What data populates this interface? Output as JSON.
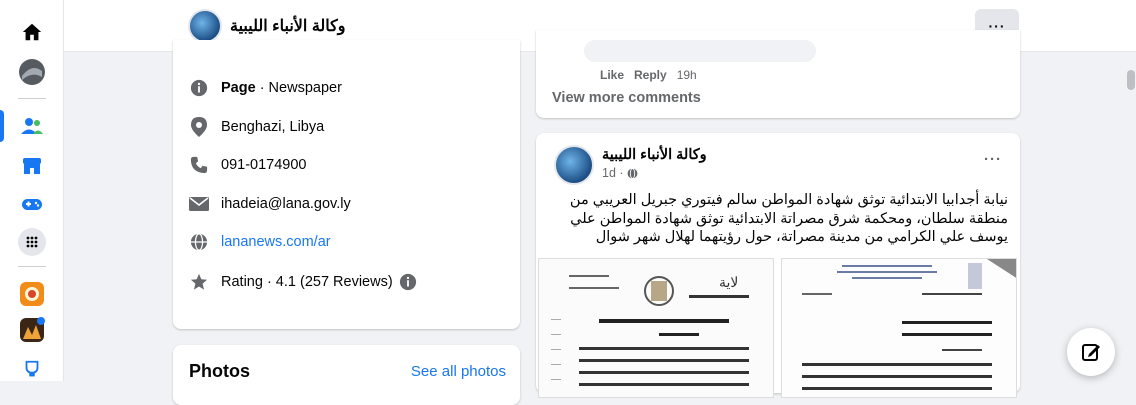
{
  "header": {
    "page_name": "وكالة الأنباء الليبية",
    "more_label": "···"
  },
  "intro": {
    "category": {
      "bold": "Page",
      "rest": " · Newspaper"
    },
    "location": "Benghazi, Libya",
    "phone": "091-0174900",
    "email": "ihadeia@lana.gov.ly",
    "website": "lananews.com/ar",
    "rating": "Rating · 4.1 (257 Reviews)"
  },
  "photos": {
    "title": "Photos",
    "see_all": "See all photos"
  },
  "comments": {
    "like": "Like",
    "reply": "Reply",
    "time": "19h",
    "view_more": "View more comments"
  },
  "post": {
    "author": "وكالة الأنباء الليبية",
    "time": "1d · ",
    "more": "···",
    "text": "نيابة أجدابيا الابتدائية توثق شهادة المواطن سالم فيتوري جبريل العريبي من منطقة سلطان، ومحكمة شرق مصراتة الابتدائية توثق شهادة المواطن علي يوسف علي الكرامي من مدينة مصراتة، حول رؤيتهما لهلال شهر شوال"
  },
  "colors": {
    "accent": "#1877f2",
    "secondary_text": "#65676b",
    "background": "#f0f2f5"
  }
}
